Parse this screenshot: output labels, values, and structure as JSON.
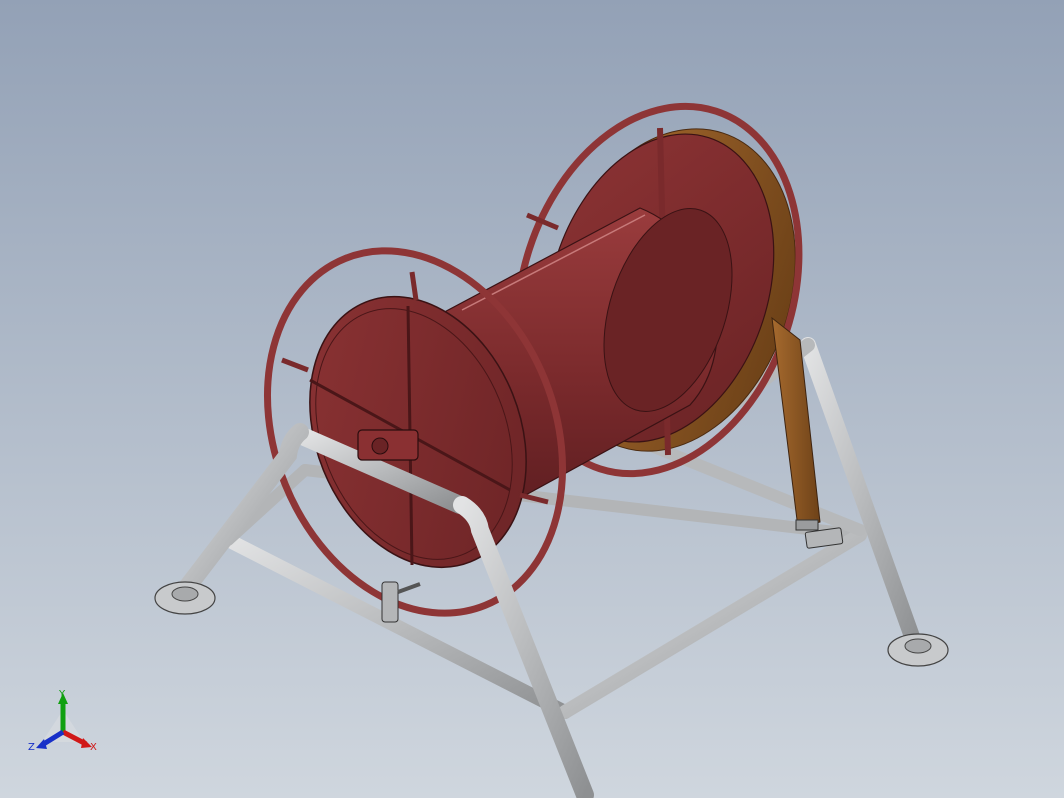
{
  "viewport": {
    "background_top": "#93a1b6",
    "background_bottom": "#cfd6de"
  },
  "model": {
    "reel_color": "#7a2a2c",
    "reel_highlight": "#9b3b3b",
    "frame_color": "#c4c6c8",
    "strap_color": "#8a5a2a"
  },
  "triad": {
    "x_label": "X",
    "y_label": "Y",
    "z_label": "Z",
    "x_color": "#d01818",
    "y_color": "#10a010",
    "z_color": "#1830c8"
  }
}
